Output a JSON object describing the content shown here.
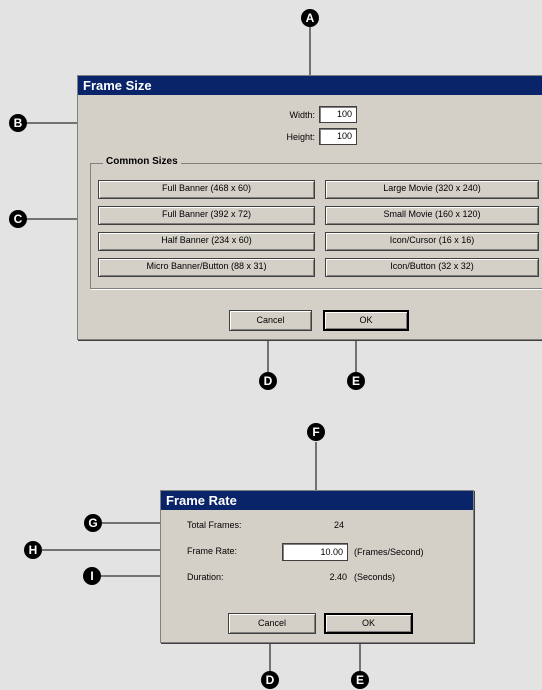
{
  "frame_size": {
    "title": "Frame Size",
    "width_label": "Width:",
    "width_value": "100",
    "height_label": "Height:",
    "height_value": "100",
    "group_label": "Common Sizes",
    "sizes_left": [
      "Full Banner (468 x 60)",
      "Full Banner (392 x 72)",
      "Half Banner (234 x 60)",
      "Micro Banner/Button (88 x 31)"
    ],
    "sizes_right": [
      "Large Movie (320 x 240)",
      "Small Movie (160 x 120)",
      "Icon/Cursor (16 x 16)",
      "Icon/Button (32 x 32)"
    ],
    "cancel_label": "Cancel",
    "ok_label": "OK"
  },
  "frame_rate": {
    "title": "Frame Rate",
    "total_frames_label": "Total Frames:",
    "total_frames_value": "24",
    "frame_rate_label": "Frame Rate:",
    "frame_rate_value": "10.00",
    "frame_rate_unit": "(Frames/Second)",
    "duration_label": "Duration:",
    "duration_value": "2.40",
    "duration_unit": "(Seconds)",
    "cancel_label": "Cancel",
    "ok_label": "OK"
  },
  "callouts": {
    "a": "A",
    "b": "B",
    "c": "C",
    "d1": "D",
    "e1": "E",
    "f": "F",
    "g": "G",
    "h": "H",
    "i": "I",
    "d2": "D",
    "e2": "E"
  }
}
